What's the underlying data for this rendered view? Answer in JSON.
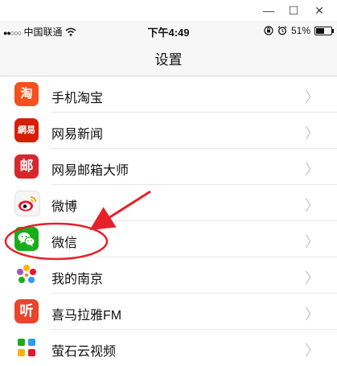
{
  "window": {
    "minimize_glyph": "—",
    "maximize_glyph": "☐",
    "close_glyph": "✕"
  },
  "status_bar": {
    "signal": "●●○○○",
    "carrier": "中国联通",
    "wifi_icon": "wifi-icon",
    "time": "下午4:49",
    "orientation_lock_icon": "orientation-lock-icon",
    "alarm_icon": "alarm-icon",
    "battery_percent": "51%",
    "battery_level": 0.51
  },
  "nav": {
    "title": "设置"
  },
  "list": {
    "items": [
      {
        "label": "手机淘宝",
        "icon_text": "淘",
        "icon": "taobao-icon",
        "color": "#f4511e"
      },
      {
        "label": "网易新闻",
        "icon_text": "網易",
        "icon": "netease-news-icon",
        "color": "#d81e06"
      },
      {
        "label": "网易邮箱大师",
        "icon_text": "邮",
        "icon": "netease-mail-icon",
        "color": "#d8262d"
      },
      {
        "label": "微博",
        "icon_text": "",
        "icon": "weibo-icon",
        "color": "#f5f5f5"
      },
      {
        "label": "微信",
        "icon_text": "",
        "icon": "wechat-icon",
        "color": "#1aad19"
      },
      {
        "label": "我的南京",
        "icon_text": "",
        "icon": "my-nanjing-icon",
        "color": "#ffffff"
      },
      {
        "label": "喜马拉雅FM",
        "icon_text": "听",
        "icon": "ximalaya-icon",
        "color": "#e8452c"
      },
      {
        "label": "萤石云视频",
        "icon_text": "",
        "icon": "ezviz-icon",
        "color": "#ffffff"
      }
    ]
  },
  "chevron_glyph": "〉",
  "annotation": {
    "highlight_color": "#e8202a",
    "highlighted_item": "微信"
  }
}
